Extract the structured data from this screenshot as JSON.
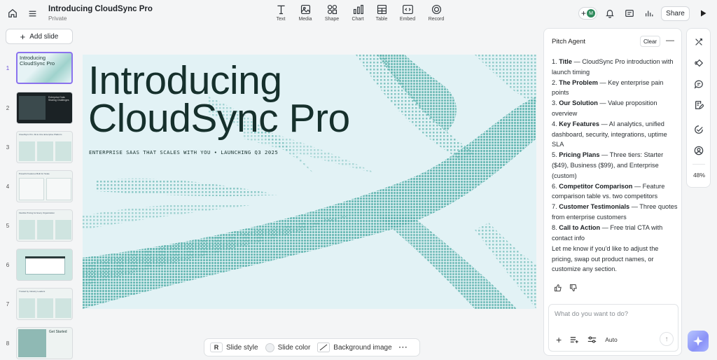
{
  "doc": {
    "title": "Introducing CloudSync Pro",
    "visibility": "Private"
  },
  "toolbar": {
    "tools": [
      {
        "label": "Text",
        "icon": "text-icon"
      },
      {
        "label": "Media",
        "icon": "media-icon"
      },
      {
        "label": "Shape",
        "icon": "shape-icon"
      },
      {
        "label": "Chart",
        "icon": "chart-icon"
      },
      {
        "label": "Table",
        "icon": "table-icon"
      },
      {
        "label": "Embed",
        "icon": "embed-icon"
      },
      {
        "label": "Record",
        "icon": "record-icon"
      }
    ],
    "share_label": "Share",
    "avatar_initial": "M"
  },
  "sidebar": {
    "add_slide_label": "Add slide",
    "slides": [
      {
        "num": "1",
        "title": "Introducing CloudSync Pro"
      },
      {
        "num": "2",
        "title": "Enterprise Data Sharing Challenges"
      },
      {
        "num": "3",
        "title": "CloudSync Pro: All-in-One Enterprise Platform"
      },
      {
        "num": "4",
        "title": "Powerful Features Built for Scale"
      },
      {
        "num": "5",
        "title": "Flexible Pricing for Every Organization"
      },
      {
        "num": "6",
        "title": ""
      },
      {
        "num": "7",
        "title": "Trusted by Industry Leaders"
      },
      {
        "num": "8",
        "title": "Get Started"
      }
    ]
  },
  "slide": {
    "title_line1": "Introducing",
    "title_line2": "CloudSync Pro",
    "tagline": "ENTERPRISE SAAS THAT SCALES WITH YOU • LAUNCHING Q3 2025"
  },
  "slide_toolbar": {
    "style_label": "Slide style",
    "style_badge": "R",
    "color_label": "Slide color",
    "bg_label": "Background image",
    "more": "···"
  },
  "agent": {
    "title": "Pitch Agent",
    "clear_label": "Clear",
    "items": [
      {
        "n": "1.",
        "head": "Title",
        "text": " — CloudSync Pro introduction with launch timing"
      },
      {
        "n": "2.",
        "head": "The Problem",
        "text": " — Key enterprise pain points"
      },
      {
        "n": "3.",
        "head": "Our Solution",
        "text": " — Value proposition overview"
      },
      {
        "n": "4.",
        "head": "Key Features",
        "text": " — AI analytics, unified dashboard, security, integrations, uptime SLA"
      },
      {
        "n": "5.",
        "head": "Pricing Plans",
        "text": " — Three tiers: Starter ($49), Business ($99), and Enterprise (custom)"
      },
      {
        "n": "6.",
        "head": "Competitor Comparison",
        "text": " — Feature comparison table vs. two competitors"
      },
      {
        "n": "7.",
        "head": "Customer Testimonials",
        "text": " — Three quotes from enterprise customers"
      },
      {
        "n": "8.",
        "head": "Call to Action",
        "text": " — Free trial CTA with contact info"
      }
    ],
    "footer": "Let me know if you'd like to adjust the pricing, swap out product names, or customize any section.",
    "prompt_placeholder": "What do you want to do?",
    "mode_label": "Auto"
  },
  "rail": {
    "zoom": "48%"
  },
  "colors": {
    "accent": "#8b72ee",
    "slide_bg": "#e2f2f5",
    "pattern": "#5cb2ad",
    "title": "#16302c"
  }
}
